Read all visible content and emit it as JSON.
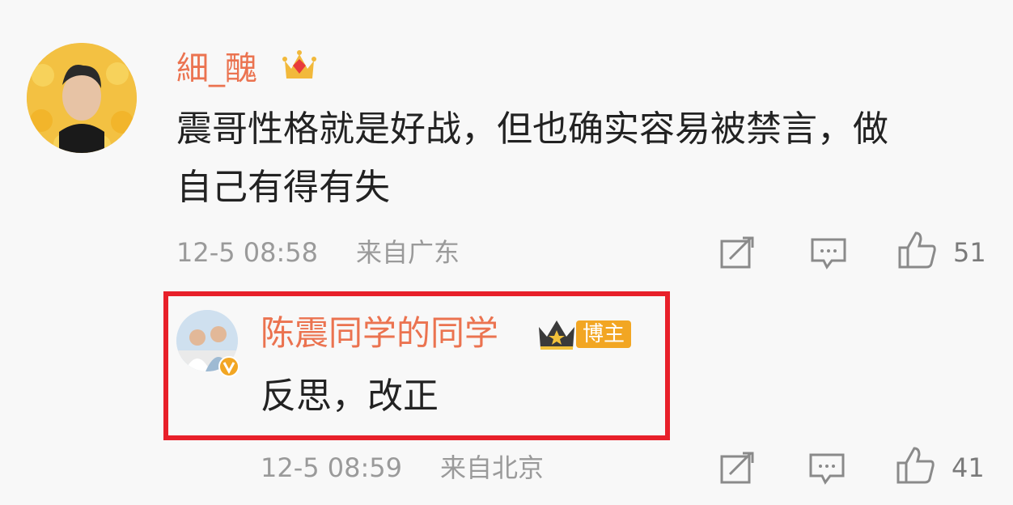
{
  "comment": {
    "author": "細_醜",
    "badge_icon": "crown-diamond-icon",
    "text_line1": "震哥性格就是好战，但也确实容易被禁言，做",
    "text_line2": "自己有得有失",
    "time": "12-5 08:58",
    "location": "来自广东",
    "likes": "51"
  },
  "reply": {
    "author": "陈震同学的同学",
    "badge_icon": "crown-icon",
    "role_badge": "博主",
    "verified_icon": "verified-v-icon",
    "text": "反思，改正",
    "time": "12-5 08:59",
    "location": "来自北京",
    "likes": "41"
  },
  "highlight_color": "#e8202a",
  "accent_color": "#eb7350"
}
